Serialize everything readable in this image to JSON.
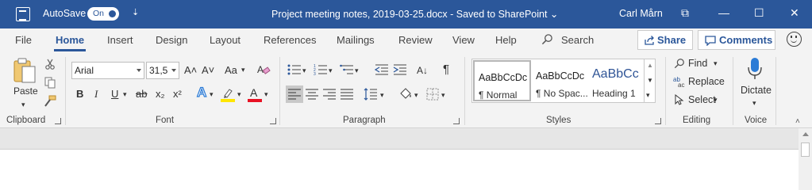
{
  "titlebar": {
    "autosave_label": "AutoSave",
    "autosave_state": "On",
    "qat_more": "⇣",
    "doc_title": "Project meeting notes, 2019-03-25.docx  -  Saved to SharePoint  ⌄",
    "user_name": "Carl Mårn",
    "btn_ribbon_options": "⧉",
    "btn_minimize": "—",
    "btn_restore": "☐",
    "btn_close": "✕"
  },
  "tabs": [
    "File",
    "Home",
    "Insert",
    "Design",
    "Layout",
    "References",
    "Mailings",
    "Review",
    "View",
    "Help"
  ],
  "search_label": "Search",
  "share_label": "Share",
  "comments_label": "Comments",
  "clipboard": {
    "paste_label": "Paste",
    "group_label": "Clipboard"
  },
  "font": {
    "font_name": "Arial",
    "font_size": "31,5",
    "group_label": "Font",
    "grow": "A˄",
    "shrink": "A˅",
    "change_case": "Aa",
    "bold": "B",
    "italic": "I",
    "underline": "U",
    "strike": "ab",
    "subscript": "x₂",
    "superscript": "x²",
    "text_effects": "A",
    "highlight": "ab",
    "font_color": "A"
  },
  "paragraph": {
    "group_label": "Paragraph",
    "pilcrow": "¶",
    "sort": "A↓"
  },
  "styles": {
    "group_label": "Styles",
    "items": [
      {
        "sample": "AaBbCcDc",
        "name": "¶ Normal"
      },
      {
        "sample": "AaBbCcDc",
        "name": "¶ No Spac..."
      },
      {
        "sample": "AaBbCc",
        "name": "Heading 1"
      }
    ]
  },
  "editing": {
    "group_label": "Editing",
    "find": "Find",
    "replace": "Replace",
    "select": "Select"
  },
  "voice": {
    "group_label": "Voice",
    "dictate": "Dictate"
  },
  "colors": {
    "titlebar": "#2b579a",
    "accent": "#2b579a",
    "highlight_yellow": "#ffe600",
    "font_red": "#e81123",
    "heading_blue": "#2f5496"
  }
}
